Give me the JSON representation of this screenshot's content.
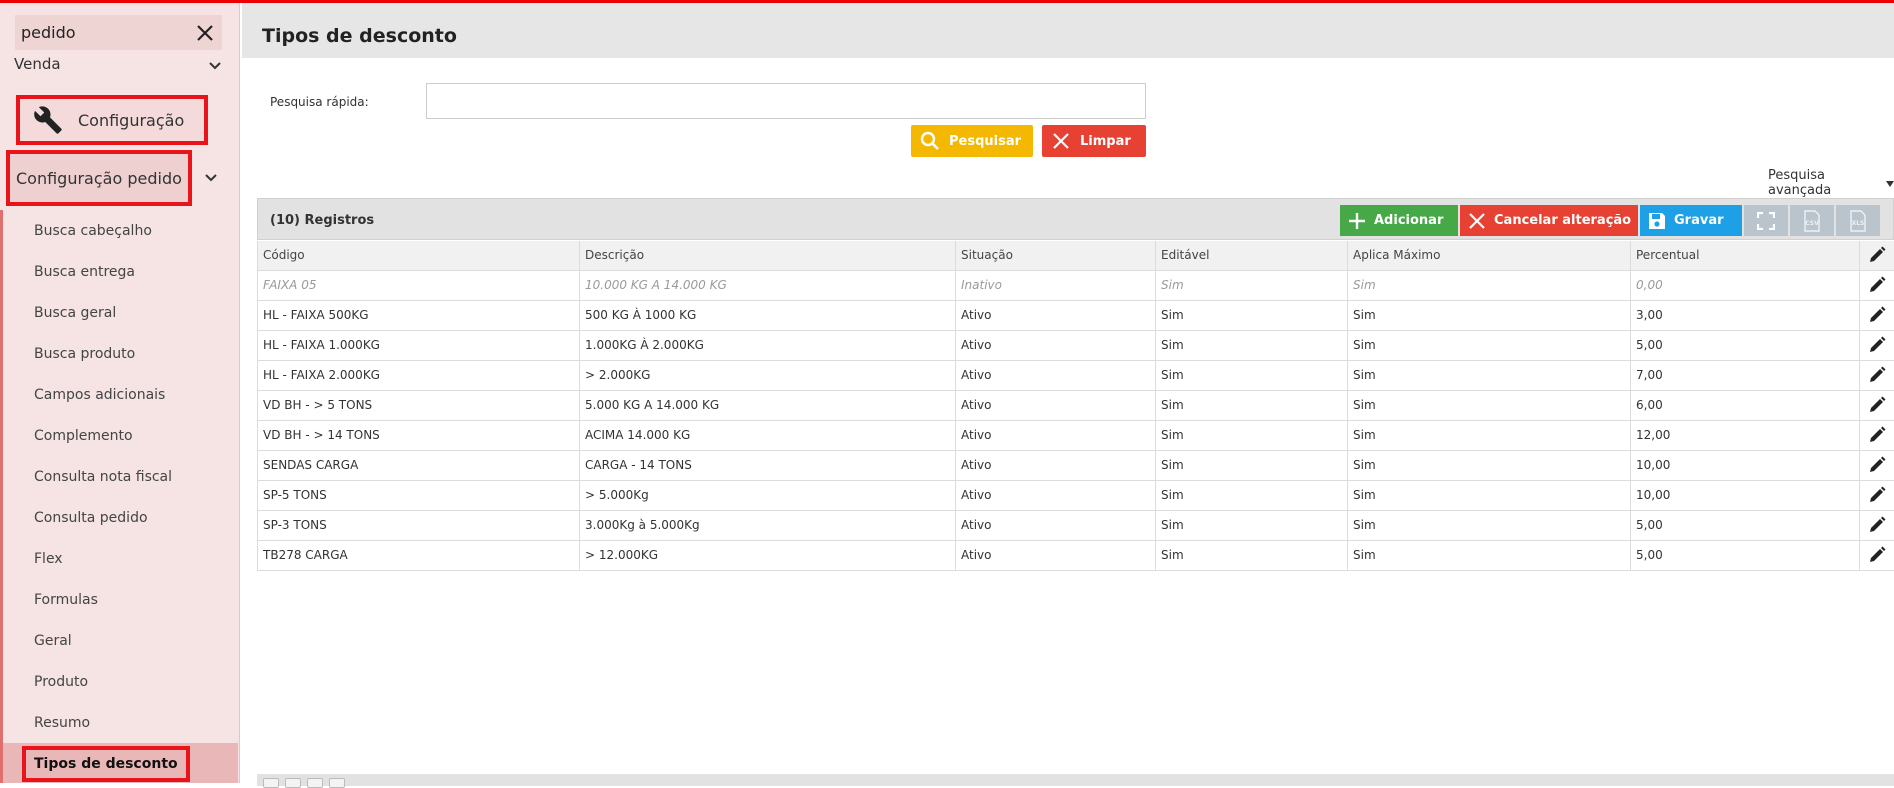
{
  "sidebar": {
    "search_value": "pedido",
    "venda_label": "Venda",
    "config_label": "Configuração",
    "config_pedido_label": "Configuração pedido",
    "items": [
      {
        "label": "Busca cabeçalho"
      },
      {
        "label": "Busca entrega"
      },
      {
        "label": "Busca geral"
      },
      {
        "label": "Busca produto"
      },
      {
        "label": "Campos adicionais"
      },
      {
        "label": "Complemento"
      },
      {
        "label": "Consulta nota fiscal"
      },
      {
        "label": "Consulta pedido"
      },
      {
        "label": "Flex"
      },
      {
        "label": "Formulas"
      },
      {
        "label": "Geral"
      },
      {
        "label": "Produto"
      },
      {
        "label": "Resumo"
      },
      {
        "label": "Tipos de desconto",
        "active": true
      }
    ]
  },
  "page": {
    "title": "Tipos de desconto",
    "quick_search_label": "Pesquisa rápida:",
    "quick_search_value": "",
    "search_button": "Pesquisar",
    "clear_button": "Limpar",
    "advanced_search": "Pesquisa avançada"
  },
  "grid": {
    "count_label": "(10) Registros",
    "add_button": "Adicionar",
    "cancel_button": "Cancelar alteração",
    "save_button": "Gravar",
    "csv_label": "CSV",
    "xls_label": "XLS",
    "columns": [
      "Código",
      "Descrição",
      "Situação",
      "Editável",
      "Aplica Máximo",
      "Percentual"
    ],
    "rows": [
      [
        "FAIXA 05",
        "10.000 KG A 14.000 KG",
        "Inativo",
        "Sim",
        "Sim",
        "0,00"
      ],
      [
        "HL - FAIXA 500KG",
        "500 KG À 1000 KG",
        "Ativo",
        "Sim",
        "Sim",
        "3,00"
      ],
      [
        "HL - FAIXA 1.000KG",
        "1.000KG À 2.000KG",
        "Ativo",
        "Sim",
        "Sim",
        "5,00"
      ],
      [
        "HL - FAIXA 2.000KG",
        "> 2.000KG",
        "Ativo",
        "Sim",
        "Sim",
        "7,00"
      ],
      [
        "VD BH - > 5 TONS",
        "5.000 KG A 14.000 KG",
        "Ativo",
        "Sim",
        "Sim",
        "6,00"
      ],
      [
        "VD BH - > 14 TONS",
        "ACIMA 14.000 KG",
        "Ativo",
        "Sim",
        "Sim",
        "12,00"
      ],
      [
        "SENDAS CARGA",
        "CARGA - 14 TONS",
        "Ativo",
        "Sim",
        "Sim",
        "10,00"
      ],
      [
        "SP-5 TONS",
        "> 5.000Kg",
        "Ativo",
        "Sim",
        "Sim",
        "10,00"
      ],
      [
        "SP-3 TONS",
        "3.000Kg à 5.000Kg",
        "Ativo",
        "Sim",
        "Sim",
        "5,00"
      ],
      [
        "TB278 CARGA",
        "> 12.000KG",
        "Ativo",
        "Sim",
        "Sim",
        "5,00"
      ]
    ]
  },
  "colors": {
    "accent_red": "#e8141a",
    "search_yellow": "#f5b800",
    "clear_red": "#e64132",
    "add_green": "#46a846",
    "save_blue": "#1ea0e6"
  }
}
